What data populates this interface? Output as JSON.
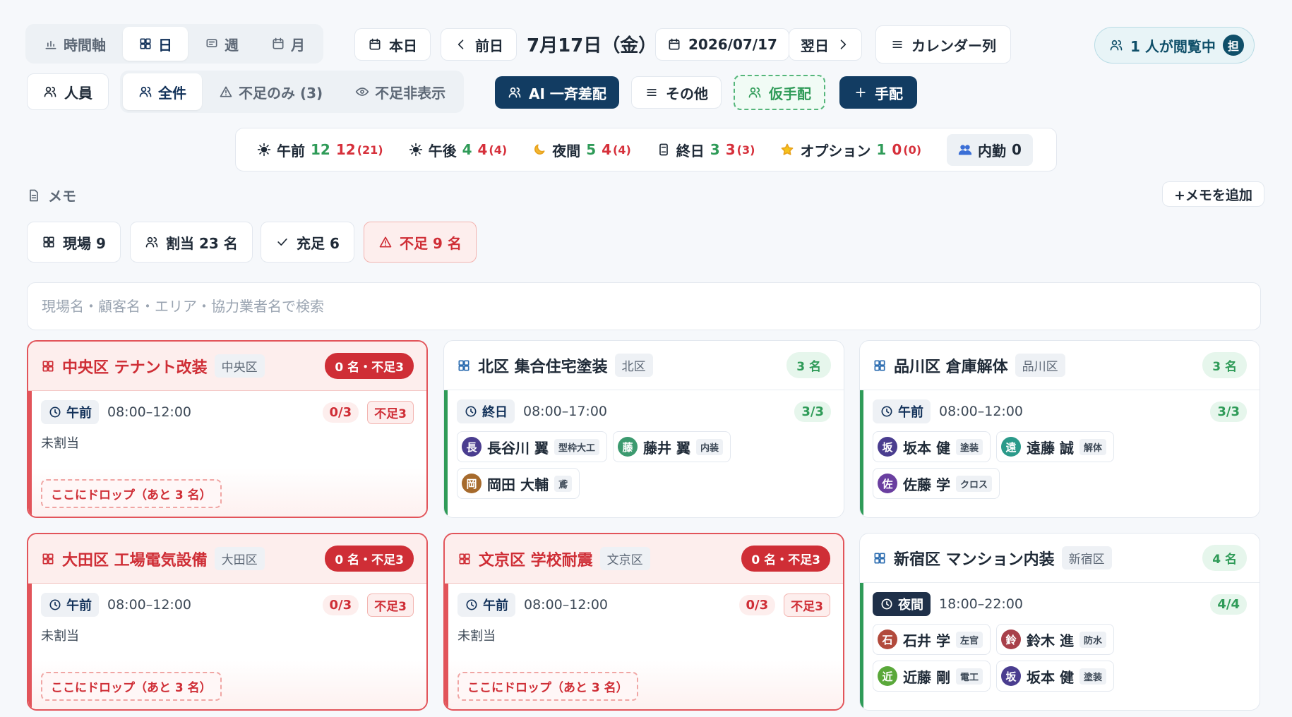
{
  "view_modes": [
    {
      "label": "時間軸",
      "icon": "bar-chart-icon",
      "active": false
    },
    {
      "label": "日",
      "icon": "grid-icon",
      "active": true
    },
    {
      "label": "週",
      "icon": "list-icon",
      "active": false
    },
    {
      "label": "月",
      "icon": "calendar-icon",
      "active": false
    }
  ],
  "nav": {
    "today": "本日",
    "prev": "前日",
    "current_date": "7月17日（金）",
    "date_picker": "2026/07/17",
    "next": "翌日",
    "calendar_columns": "カレンダー列"
  },
  "viewers": {
    "label": "1 人が閲覧中",
    "badge": "担"
  },
  "filters": {
    "staff": "人員",
    "tabs": [
      "全件",
      "不足のみ (3)",
      "不足非表示"
    ],
    "ai_assign": "AI 一斉差配",
    "other": "その他",
    "temp_assign": "仮手配",
    "add_assign": "手配"
  },
  "summary": [
    {
      "label": "午前",
      "icon": "sun-icon",
      "a": "12",
      "b": "12",
      "c": "(21)"
    },
    {
      "label": "午後",
      "icon": "sun-icon",
      "a": "4",
      "b": "4",
      "c": "(4)"
    },
    {
      "label": "夜間",
      "icon": "moon-icon",
      "a": "5",
      "b": "4",
      "c": "(4)"
    },
    {
      "label": "終日",
      "icon": "hourglass-icon",
      "a": "3",
      "b": "3",
      "c": "(3)"
    },
    {
      "label": "オプション",
      "icon": "star-icon",
      "a": "1",
      "b": "0",
      "c": "(0)"
    }
  ],
  "internal": {
    "label": "内勤",
    "value": "0"
  },
  "memo": {
    "label": "メモ",
    "add": "+メモを追加"
  },
  "stats": {
    "sites": "現場 9",
    "assigned": "割当 23 名",
    "filled": "充足 6",
    "shortage": "不足 9 名"
  },
  "search": {
    "placeholder": "現場名・顧客名・エリア・協力業者名で検索"
  },
  "cards": [
    {
      "title": "中央区 テナント改装",
      "area": "中央区",
      "badge": "0 名・不足3",
      "status": "short",
      "slot": "午前",
      "time": "08:00–12:00",
      "ratio": "0/3",
      "lack": "不足3",
      "unassigned": "未割当",
      "drop": "ここにドロップ（あと 3 名）",
      "people": []
    },
    {
      "title": "北区 集合住宅塗装",
      "area": "北区",
      "badge": "3 名",
      "status": "ok",
      "slot": "終日",
      "time": "08:00–17:00",
      "ratio": "3/3",
      "people": [
        {
          "initial": "長",
          "name": "長谷川 翼",
          "role": "型枠大工",
          "color": "#4a3d8f"
        },
        {
          "initial": "藤",
          "name": "藤井 翼",
          "role": "内装",
          "color": "#3c9a6f"
        },
        {
          "initial": "岡",
          "name": "岡田 大輔",
          "role": "鳶",
          "color": "#a66a2c"
        }
      ]
    },
    {
      "title": "品川区 倉庫解体",
      "area": "品川区",
      "badge": "3 名",
      "status": "ok",
      "slot": "午前",
      "time": "08:00–12:00",
      "ratio": "3/3",
      "people": [
        {
          "initial": "坂",
          "name": "坂本 健",
          "role": "塗装",
          "color": "#4a3d8f"
        },
        {
          "initial": "遠",
          "name": "遠藤 誠",
          "role": "解体",
          "color": "#2b9a8a"
        },
        {
          "initial": "佐",
          "name": "佐藤 学",
          "role": "クロス",
          "color": "#6a3fa0"
        }
      ]
    },
    {
      "title": "大田区 工場電気設備",
      "area": "大田区",
      "badge": "0 名・不足3",
      "status": "short",
      "slot": "午前",
      "time": "08:00–12:00",
      "ratio": "0/3",
      "lack": "不足3",
      "unassigned": "未割当",
      "drop": "ここにドロップ（あと 3 名）",
      "people": []
    },
    {
      "title": "文京区 学校耐震",
      "area": "文京区",
      "badge": "0 名・不足3",
      "status": "short",
      "slot": "午前",
      "time": "08:00–12:00",
      "ratio": "0/3",
      "lack": "不足3",
      "unassigned": "未割当",
      "drop": "ここにドロップ（あと 3 名）",
      "people": []
    },
    {
      "title": "新宿区 マンション内装",
      "area": "新宿区",
      "badge": "4 名",
      "status": "ok",
      "slot": "夜間",
      "time": "18:00–22:00",
      "ratio": "4/4",
      "people": [
        {
          "initial": "石",
          "name": "石井 学",
          "role": "左官",
          "color": "#b24a3c"
        },
        {
          "initial": "鈴",
          "name": "鈴木 進",
          "role": "防水",
          "color": "#a8404a"
        },
        {
          "initial": "近",
          "name": "近藤 剛",
          "role": "電工",
          "color": "#5aa83a"
        },
        {
          "initial": "坂",
          "name": "坂本 健",
          "role": "塗装",
          "color": "#4a3d8f"
        }
      ]
    }
  ]
}
